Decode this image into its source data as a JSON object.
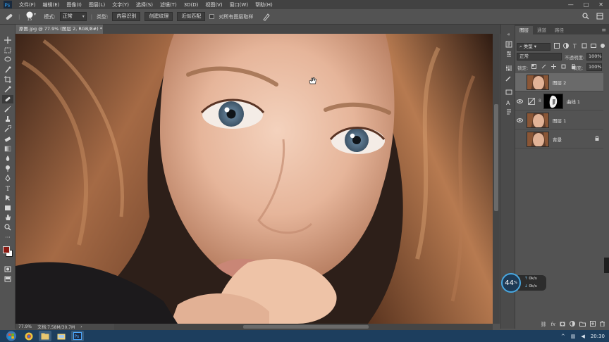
{
  "menubar": {
    "items": [
      "文件(F)",
      "编辑(E)",
      "图像(I)",
      "图层(L)",
      "文字(Y)",
      "选择(S)",
      "滤镜(T)",
      "3D(D)",
      "视图(V)",
      "窗口(W)",
      "帮助(H)"
    ]
  },
  "options": {
    "brush_size": "15",
    "mode_label": "模式:",
    "mode_value": "正常",
    "type_label": "类型:",
    "type_buttons": [
      "内容识别",
      "创建纹理",
      "近似匹配"
    ],
    "sample_all_label": "对所有图层取样"
  },
  "document": {
    "tab_title": "原图.jpg @ 77.9% (图层 2, RGB/8#) *",
    "zoom": "77.9%",
    "doc_size": "文档:7.58M/30.7M"
  },
  "layers_panel": {
    "tabs": [
      "图层",
      "通道",
      "路径"
    ],
    "kind_filter": "类型",
    "blend_mode": "正常",
    "opacity_label": "不透明度:",
    "opacity_value": "100%",
    "lock_label": "锁定:",
    "fill_label": "填充:",
    "fill_value": "100%",
    "layers": [
      {
        "name": "图层 2",
        "selected": true
      },
      {
        "name": "曲线 1",
        "selected": false
      },
      {
        "name": "图层 1",
        "selected": false
      },
      {
        "name": "背景",
        "selected": false
      }
    ]
  },
  "net_widget": {
    "percent": "44",
    "unit": "%",
    "up": "0k/s",
    "down": "0k/s"
  },
  "taskbar": {
    "clock": "20:30"
  },
  "colors": {
    "accent": "#48a7e0",
    "foreground_swatch": "#8b1a12",
    "background_swatch": "#ffffff"
  }
}
